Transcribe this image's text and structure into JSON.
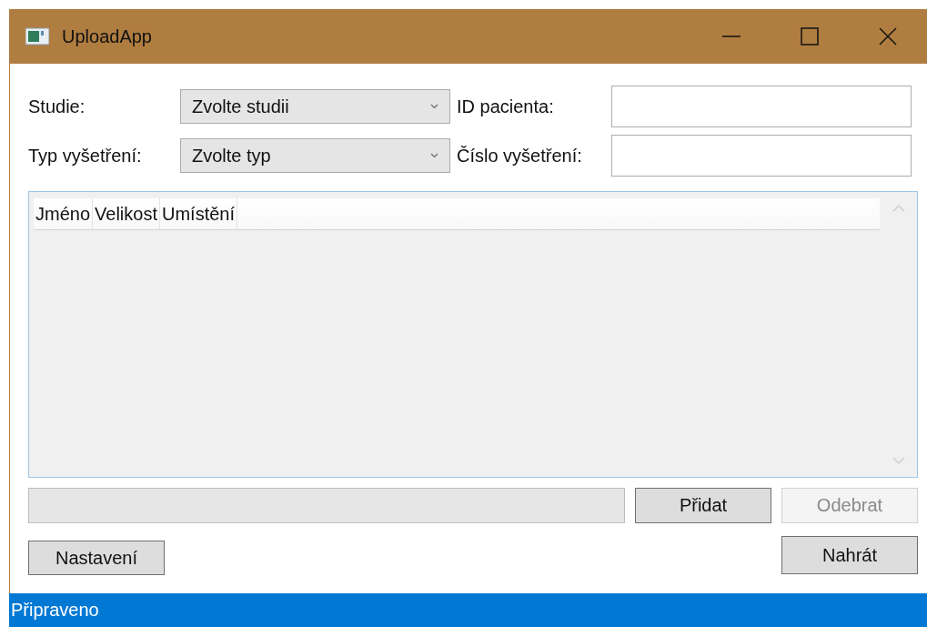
{
  "window": {
    "title": "UploadApp"
  },
  "form": {
    "rows": [
      {
        "label": "Studie:",
        "combo": {
          "value": "Zvolte studii"
        },
        "side_label": "ID pacienta:"
      },
      {
        "label": "Typ vyšetření:",
        "combo": {
          "value": "Zvolte typ"
        },
        "side_label": "Číslo vyšetření:"
      }
    ]
  },
  "file_list": {
    "columns": [
      "Jméno",
      "Velikost",
      "Umístění"
    ]
  },
  "progress": {
    "level": 0
  },
  "buttons": [
    {
      "label": "Přidat",
      "disabled": false
    },
    {
      "label": "Odebrat",
      "disabled": true
    },
    {
      "label": "Nastavení",
      "disabled": false
    },
    {
      "label": "Nahrát",
      "disabled": false
    }
  ],
  "status_bar": {
    "text": "Připraveno"
  }
}
